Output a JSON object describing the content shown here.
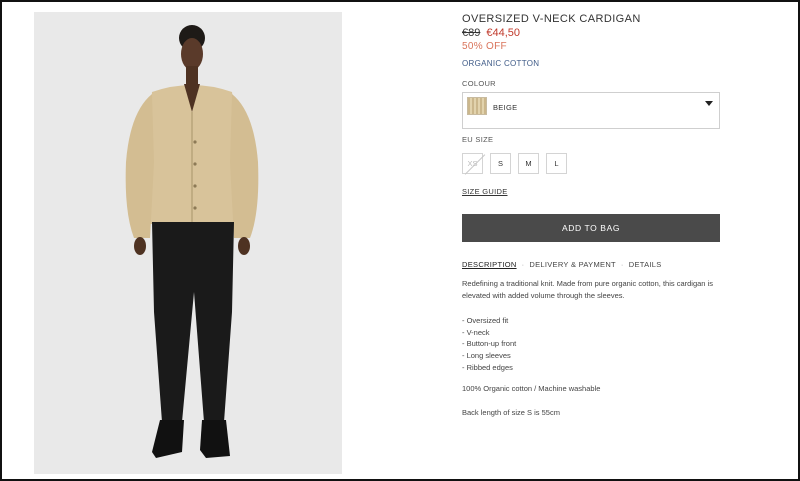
{
  "product": {
    "title": "OVERSIZED V-NECK CARDIGAN",
    "price_original": "€89",
    "price_sale": "€44,50",
    "discount": "50% OFF",
    "material": "ORGANIC COTTON",
    "image_alt": "model-wearing-beige-cardigan"
  },
  "colour": {
    "label": "COLOUR",
    "selected": "BEIGE",
    "swatch_color": "#d8c7a0",
    "icon": "chevron-down-icon"
  },
  "size": {
    "label": "EU SIZE",
    "options": [
      {
        "label": "XS",
        "available": false
      },
      {
        "label": "S",
        "available": true
      },
      {
        "label": "M",
        "available": true
      },
      {
        "label": "L",
        "available": true
      }
    ],
    "guide_label": "SIZE GUIDE"
  },
  "cta": {
    "add_to_bag": "ADD TO BAG"
  },
  "tabs": [
    {
      "label": "DESCRIPTION",
      "active": true
    },
    {
      "label": "DELIVERY & PAYMENT",
      "active": false
    },
    {
      "label": "DETAILS",
      "active": false
    }
  ],
  "description": {
    "text": "Redefining a traditional knit. Made from pure organic cotton, this cardigan is elevated with added volume through the sleeves.",
    "features": [
      "- Oversized fit",
      "- V-neck",
      "- Button-up front",
      "- Long sleeves",
      "- Ribbed edges"
    ],
    "composition": "100% Organic cotton / Machine washable",
    "back_length": "Back length of size S is 55cm"
  },
  "colors": {
    "sale_price": "#c0392b",
    "discount": "#d9735a",
    "material_link": "#3e5a87",
    "button": "#4a4a4a"
  }
}
